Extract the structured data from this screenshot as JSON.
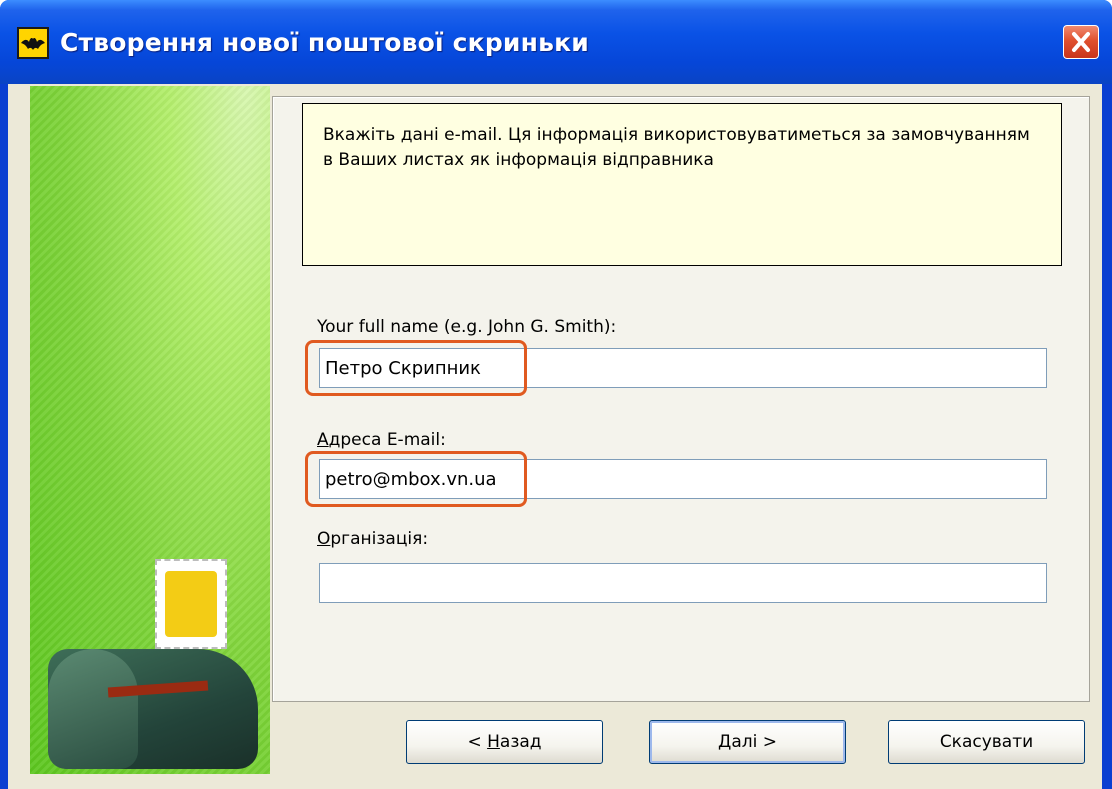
{
  "window": {
    "title": "Створення нової поштової скриньки"
  },
  "info": {
    "text": "Вкажіть дані e-mail. Ця інформація використовуватиметься за замовчуванням в Ваших листах як інформація відправника"
  },
  "form": {
    "full_name_label": "Your full name (e.g. John G. Smith):",
    "full_name_value": "Петро Скрипник",
    "email_label_first": "А",
    "email_label_rest": "дреса E-mail:",
    "email_value": "petro@mbox.vn.ua",
    "org_label_first": "О",
    "org_label_rest": "рганізація:",
    "org_value": ""
  },
  "buttons": {
    "back_prefix": "< ",
    "back_hotkey": "Н",
    "back_rest": "азад",
    "next_hotkey": "Д",
    "next_rest": "алі  >",
    "cancel": "Скасувати"
  },
  "colors": {
    "titlebar": "#0a52e6",
    "info_background": "#ffffe1",
    "highlight": "#e05a20",
    "side_panel": "#7fd43a"
  },
  "icons": {
    "app": "bat-icon",
    "close": "close-icon",
    "illustration": "mailbox-illustration"
  }
}
